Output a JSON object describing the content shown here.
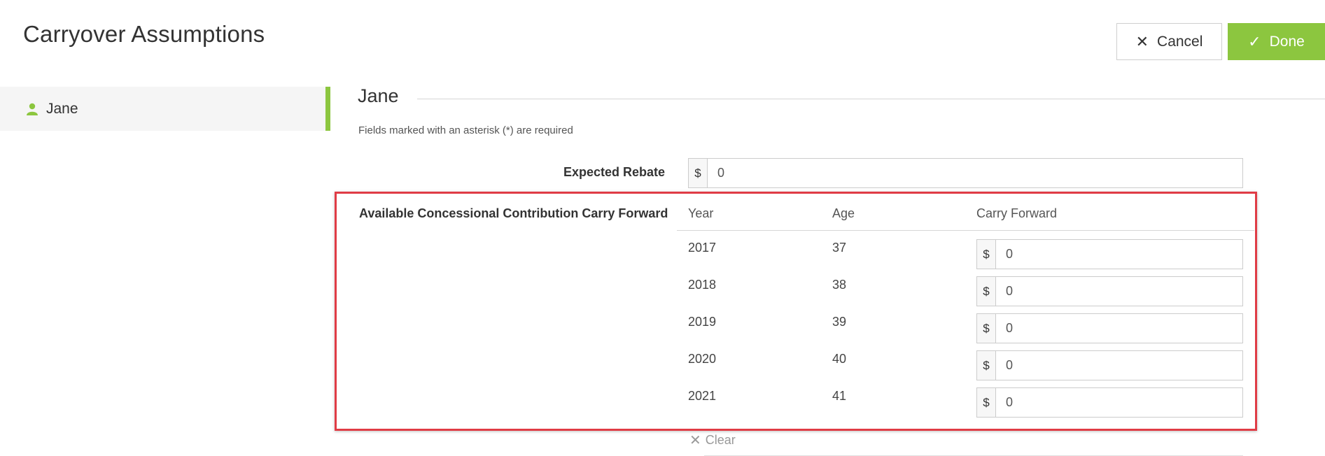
{
  "header": {
    "title": "Carryover Assumptions",
    "cancel_label": "Cancel",
    "done_label": "Done"
  },
  "sidebar": {
    "items": [
      {
        "label": "Jane",
        "icon": "user-icon",
        "active": true
      }
    ]
  },
  "form": {
    "section_title": "Jane",
    "required_note": "Fields marked with an asterisk (*) are required",
    "expected_rebate": {
      "label": "Expected Rebate",
      "currency": "$",
      "value": "0"
    },
    "carry_forward": {
      "label": "Available Concessional Contribution Carry Forward",
      "columns": [
        "Year",
        "Age",
        "Carry Forward"
      ],
      "currency": "$",
      "rows": [
        {
          "year": "2017",
          "age": "37",
          "value": "0"
        },
        {
          "year": "2018",
          "age": "38",
          "value": "0"
        },
        {
          "year": "2019",
          "age": "39",
          "value": "0"
        },
        {
          "year": "2020",
          "age": "40",
          "value": "0"
        },
        {
          "year": "2021",
          "age": "41",
          "value": "0"
        }
      ],
      "clear_label": "Clear"
    }
  },
  "colors": {
    "accent": "#8cc63f",
    "highlight": "#e03c46"
  }
}
